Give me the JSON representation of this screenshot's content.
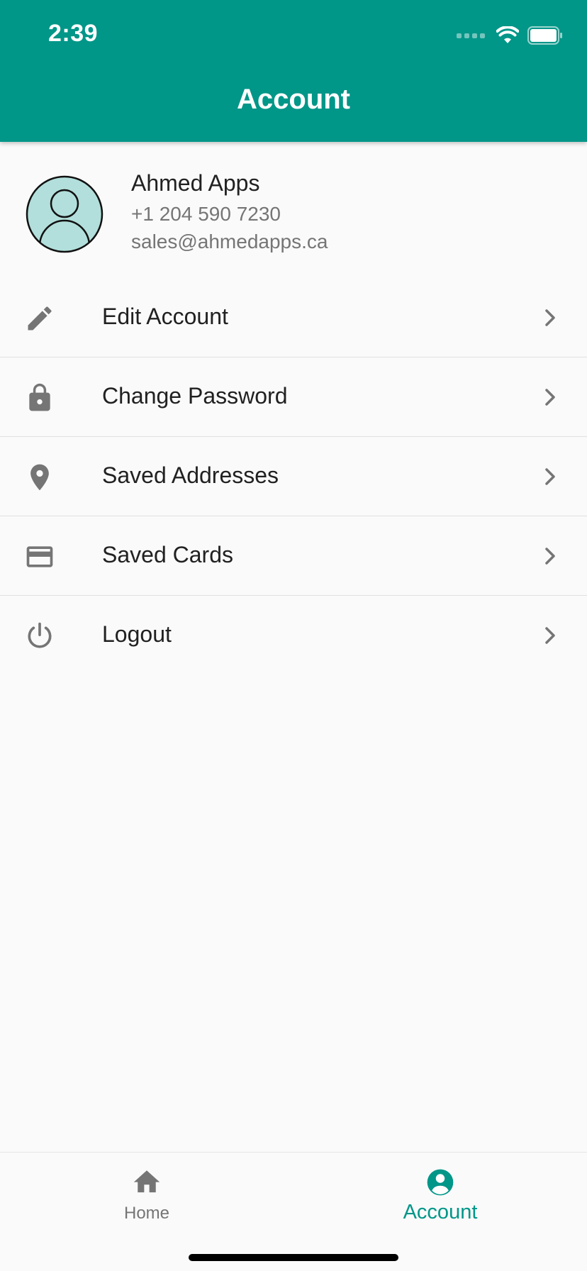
{
  "status_bar": {
    "time": "2:39"
  },
  "header": {
    "title": "Account"
  },
  "profile": {
    "name": "Ahmed Apps",
    "phone": "+1 204 590 7230",
    "email": "sales@ahmedapps.ca",
    "avatar_icon": "person-circle-icon"
  },
  "menu": {
    "items": [
      {
        "label": "Edit Account",
        "icon": "pencil-icon"
      },
      {
        "label": "Change Password",
        "icon": "lock-icon"
      },
      {
        "label": "Saved Addresses",
        "icon": "location-pin-icon"
      },
      {
        "label": "Saved Cards",
        "icon": "credit-card-icon"
      },
      {
        "label": "Logout",
        "icon": "power-icon"
      }
    ]
  },
  "bottom_nav": {
    "items": [
      {
        "label": "Home",
        "icon": "home-icon",
        "active": false
      },
      {
        "label": "Account",
        "icon": "account-circle-icon",
        "active": true
      }
    ]
  },
  "colors": {
    "primary": "#009688",
    "background": "#fafafa",
    "icon_gray": "#757575",
    "avatar_fill": "#b2dfdb",
    "text_primary": "#212121",
    "text_secondary": "#757575",
    "divider": "#e0e0e0"
  }
}
